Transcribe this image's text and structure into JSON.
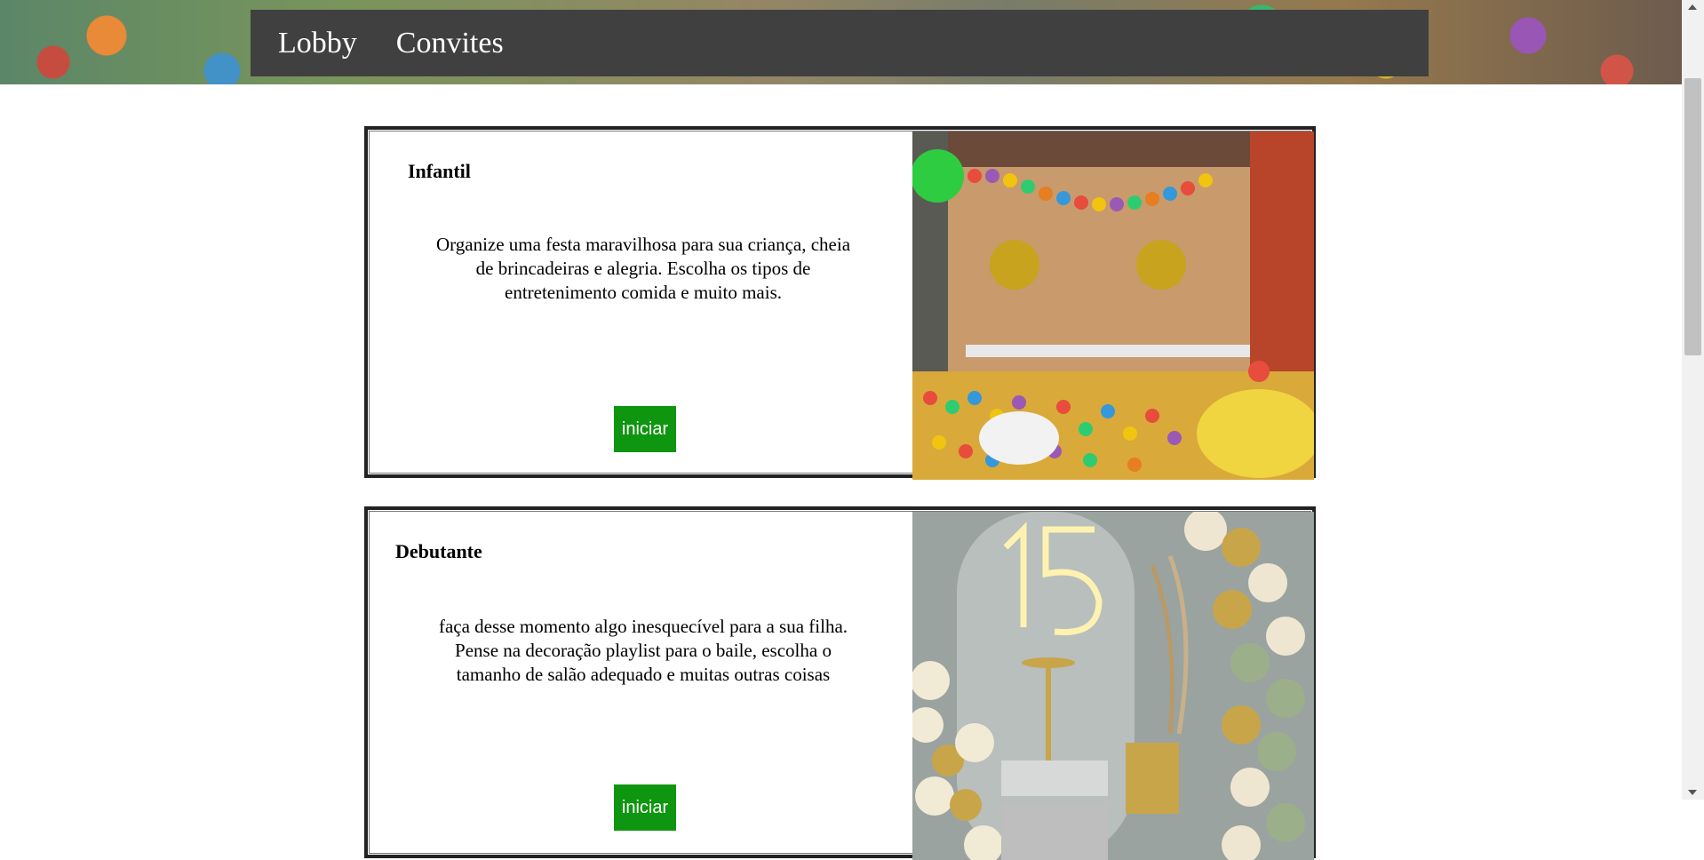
{
  "nav": {
    "items": [
      {
        "label": "Lobby"
      },
      {
        "label": "Convites"
      }
    ]
  },
  "cards": [
    {
      "title": "Infantil",
      "description": "Organize uma festa maravilhosa para sua criança, cheia de brincadeiras e alegria. Escolha os tipos de entretenimento comida e muito mais.",
      "button_label": "iniciar",
      "image_icon": "kids-party-photo"
    },
    {
      "title": "Debutante",
      "description": "faça desse momento algo inesquecível para a sua filha. Pense na decoração playlist para o baile, escolha o tamanho de salão adequado e muitas outras coisas",
      "button_label": "iniciar",
      "image_icon": "debutante-party-photo"
    }
  ],
  "colors": {
    "nav_bg": "#404040",
    "button_bg": "#0f9610",
    "card_border": "#222222"
  }
}
